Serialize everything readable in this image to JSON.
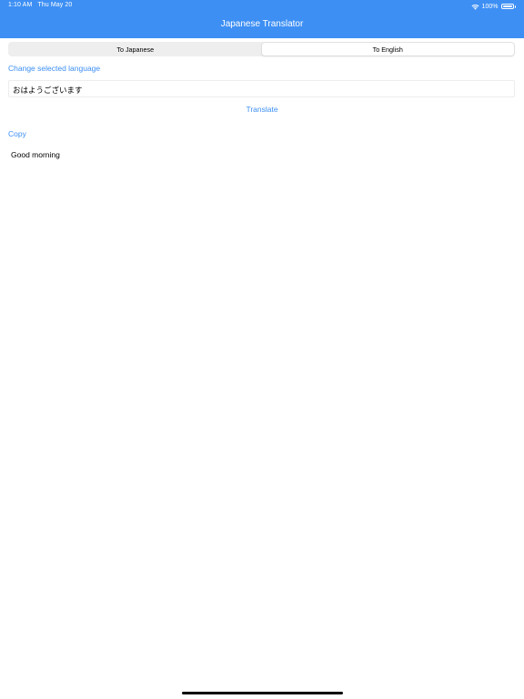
{
  "status_bar": {
    "time": "1:10 AM",
    "date": "Thu May 20",
    "battery": "100%",
    "battery_level": 1.0
  },
  "nav": {
    "title": "Japanese Translator"
  },
  "segmented_control": {
    "options": [
      "To Japanese",
      "To English"
    ],
    "selected_index": 1
  },
  "change_language_label": "Change selected language",
  "input": {
    "value": "おはようございます"
  },
  "translate_label": "Translate",
  "copy_label": "Copy",
  "output_text": "Good morning",
  "colors": {
    "accent": "#3d8ff4",
    "background": "#ffffff"
  },
  "icons": [
    "wifi-icon",
    "battery-icon"
  ]
}
